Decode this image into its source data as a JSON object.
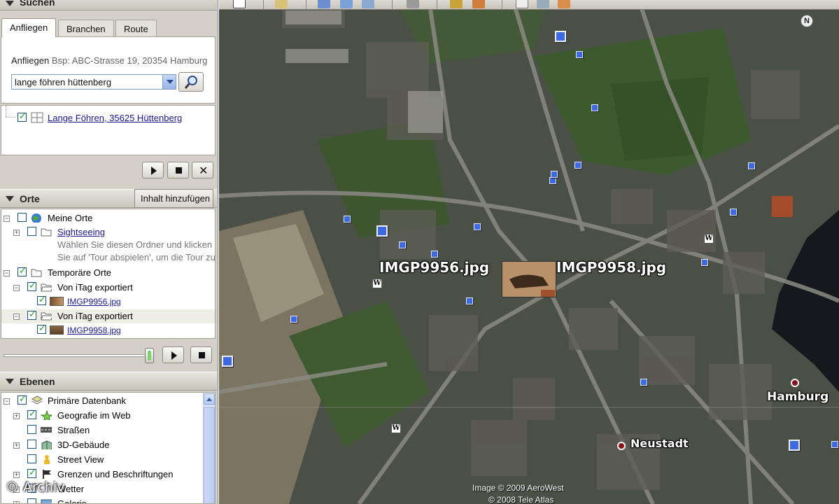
{
  "search": {
    "title": "Suchen",
    "tabs": [
      "Anfliegen",
      "Branchen",
      "Route"
    ],
    "hint_label": "Anfliegen",
    "hint_text": "Bsp: ABC-Strasse 19, 20354 Hamburg",
    "query": "lange föhren hüttenberg",
    "result": "Lange Föhren, 35625 Hüttenberg"
  },
  "places": {
    "title": "Orte",
    "add_content": "Inhalt hinzufügen",
    "items": [
      {
        "label": "Meine Orte",
        "checked": false
      },
      {
        "label": "Sightseeing",
        "checked": false
      },
      {
        "label": "Temporäre Orte",
        "checked": true
      },
      {
        "label": "Von iTag exportiert",
        "checked": true
      },
      {
        "label": "IMGP9956.jpg",
        "checked": true
      },
      {
        "label": "Von iTag exportiert",
        "checked": true
      },
      {
        "label": "IMGP9958.jpg",
        "checked": true
      }
    ],
    "sightseeing_desc_1": "Wählen Sie diesen Ordner und klicken",
    "sightseeing_desc_2": "Sie auf 'Tour abspielen', um die Tour zu"
  },
  "tour_slider": {
    "position": 0.96
  },
  "layers": {
    "title": "Ebenen",
    "items": [
      {
        "label": "Primäre Datenbank",
        "checked": true
      },
      {
        "label": "Geografie im Web",
        "checked": true
      },
      {
        "label": "Straßen",
        "checked": false
      },
      {
        "label": "3D-Gebäude",
        "checked": false
      },
      {
        "label": "Street View",
        "checked": false
      },
      {
        "label": "Grenzen und Beschriftungen",
        "checked": true
      },
      {
        "label": "Wetter",
        "checked": false
      },
      {
        "label": "Galerie",
        "checked": false
      }
    ]
  },
  "map": {
    "photo_labels": [
      "IMGP9956.jpg",
      "IMGP9958.jpg"
    ],
    "places": [
      "Hamburg",
      "Neustadt"
    ],
    "compass": "N",
    "copyright_1": "Image © 2009 AeroWest",
    "copyright_2": "© 2008 Tele Atlas"
  },
  "watermark": "© Archiv",
  "colors": {
    "accent_blue": "#3d6ae0",
    "link": "#1a1a8c",
    "place_dot": "#8c0f1a"
  }
}
